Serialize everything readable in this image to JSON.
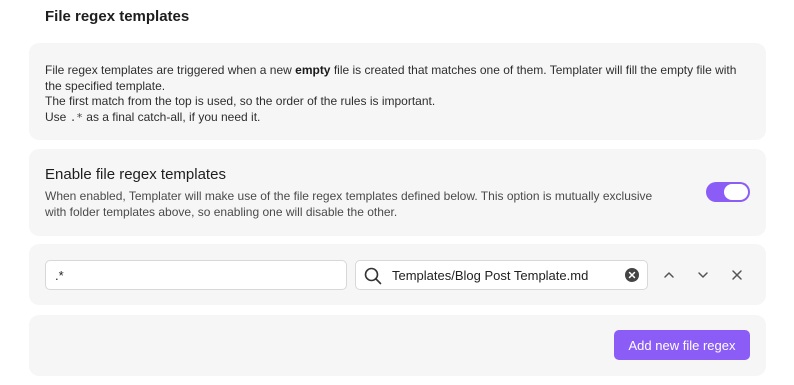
{
  "section": {
    "heading": "File regex templates"
  },
  "description": {
    "line1_before": "File regex templates are triggered when a new ",
    "line1_bold": "empty",
    "line1_after": " file is created that matches one of them. Templater will fill the empty file with the specified template.",
    "line2": "The first match from the top is used, so the order of the rules is important.",
    "line3_before": "Use ",
    "line3_code": ".*",
    "line3_after": " as a final catch-all, if you need it."
  },
  "toggle_setting": {
    "title": "Enable file regex templates",
    "description": "When enabled, Templater will make use of the file regex templates defined below. This option is mutually exclusive with folder templates above, so enabling one will disable the other.",
    "enabled": true,
    "accent_color": "#8b5cf6"
  },
  "rules": [
    {
      "regex": ".*",
      "template": "Templates/Blog Post Template.md"
    }
  ],
  "icons": {
    "search": "search-icon",
    "clear": "clear-circle-icon",
    "up": "chevron-up-icon",
    "down": "chevron-down-icon",
    "remove": "close-icon"
  },
  "add_button": {
    "label": "Add new file regex"
  }
}
